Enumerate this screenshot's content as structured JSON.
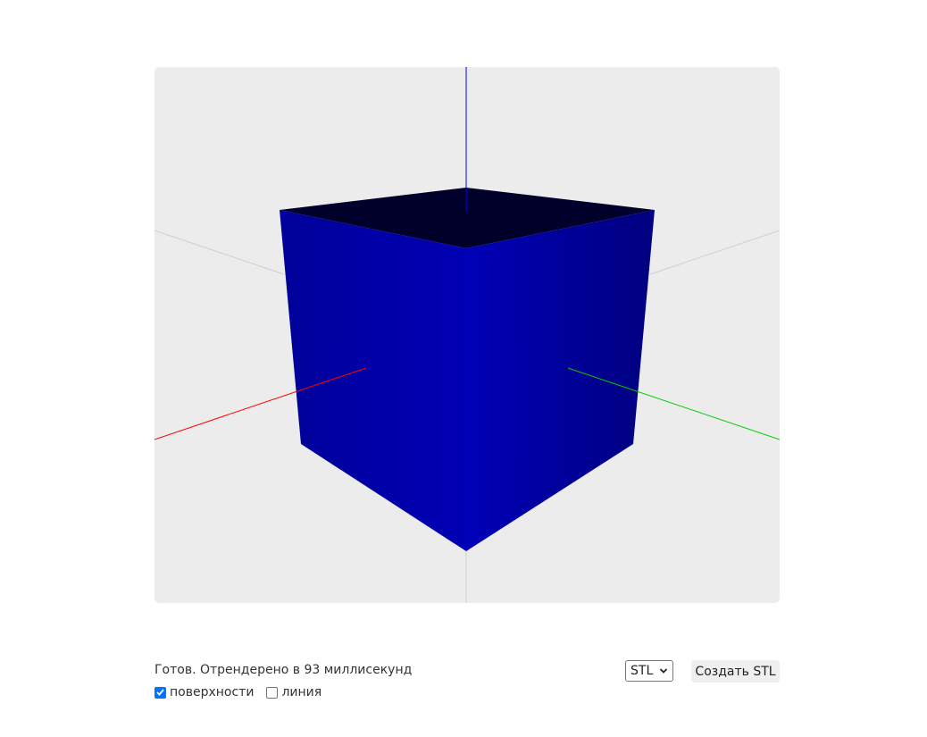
{
  "viewer": {
    "background": "#ececec",
    "model": "cube",
    "model_color": "#0000a8",
    "axis_colors": {
      "x": "#ff0000",
      "y": "#00cc00",
      "z": "#0000ff",
      "grid": "#cfcfcf"
    }
  },
  "status": {
    "text": "Готов. Отрендерено в 93 миллисекунд"
  },
  "options": {
    "faces": {
      "label": "поверхности",
      "checked": true
    },
    "lines": {
      "label": "линия",
      "checked": false
    }
  },
  "export": {
    "format": "STL",
    "generate_label": "Создать STL"
  }
}
